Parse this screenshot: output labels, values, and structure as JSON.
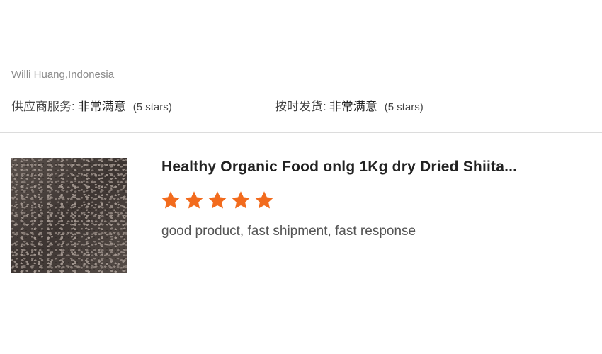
{
  "review": {
    "reviewer": "Willi Huang,Indonesia",
    "ratings": [
      {
        "label": "供应商服务:",
        "value": "非常满意",
        "stars_text": "(5 stars)"
      },
      {
        "label": "按时发货:",
        "value": "非常满意",
        "stars_text": "(5 stars)"
      }
    ]
  },
  "product": {
    "image_icon": "dried-shiitake-photo",
    "title": "Healthy Organic Food onlg 1Kg dry Dried Shiita...",
    "rating": 5,
    "rating_max": 5,
    "comment": "good product, fast shipment, fast response"
  },
  "colors": {
    "star": "#f26b1d",
    "divider": "#dcdcdc",
    "muted_text": "#8a8a8a"
  }
}
